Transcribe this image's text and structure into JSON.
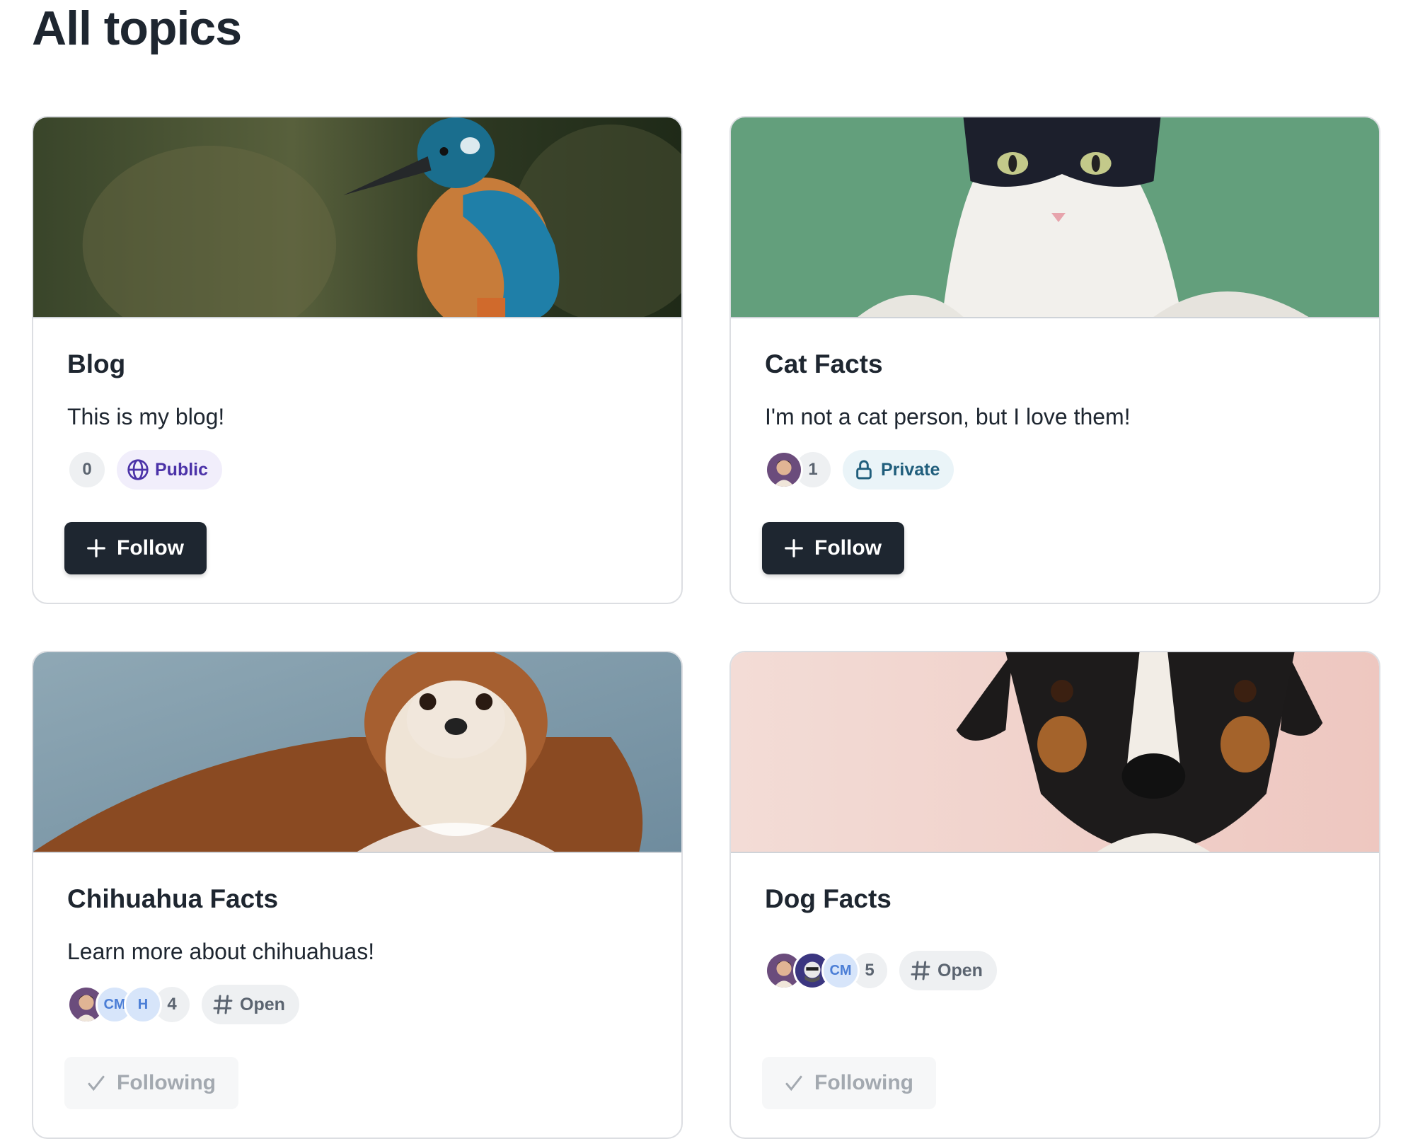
{
  "page": {
    "title": "All topics"
  },
  "cards": [
    {
      "title": "Blog",
      "description": "This is my blog!",
      "member_count": "0",
      "visibility": "Public",
      "button": "Follow"
    },
    {
      "title": "Cat Facts",
      "description": "I'm not a cat person, but I love them!",
      "member_count": "1",
      "visibility": "Private",
      "button": "Follow"
    },
    {
      "title": "Chihuahua Facts",
      "description": "Learn more about chihuahuas!",
      "avatars": [
        "",
        "CM",
        "H"
      ],
      "member_count": "4",
      "visibility": "Open",
      "button": "Following"
    },
    {
      "title": "Dog Facts",
      "description": "",
      "avatars": [
        "",
        "",
        "CM"
      ],
      "member_count": "5",
      "visibility": "Open",
      "button": "Following"
    }
  ],
  "icons": {
    "public": "globe-icon",
    "private": "lock-icon",
    "open": "hash-icon",
    "follow": "plus-icon",
    "following": "check-icon"
  },
  "colors": {
    "primary_button": "#1e2630",
    "public_badge_bg": "#f1eefb",
    "public_badge_text": "#4b32a8",
    "private_badge_bg": "#eaf4f8",
    "private_badge_text": "#205e7c"
  }
}
